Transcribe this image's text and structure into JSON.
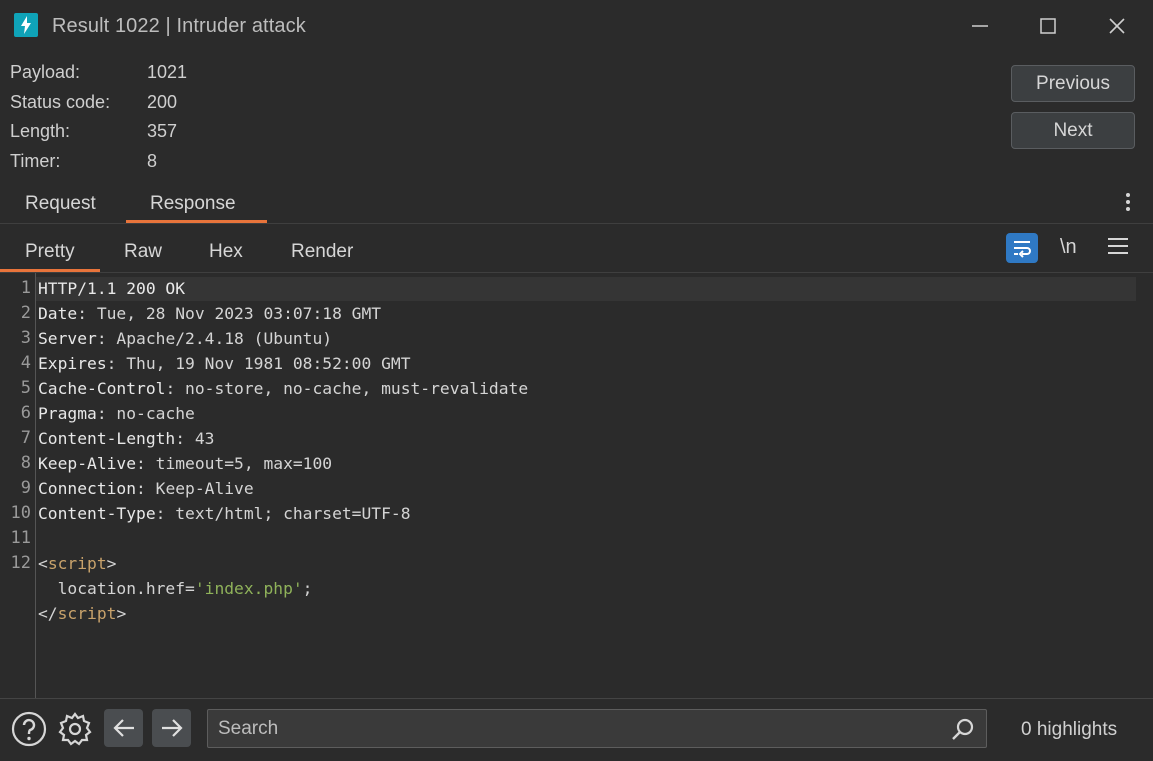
{
  "window": {
    "title": "Result 1022 | Intruder attack",
    "icon": "burp-lightning-icon",
    "accent_color": "#0fa3b8"
  },
  "info": {
    "payload_label": "Payload:",
    "payload_value": "1021",
    "status_label": "Status code:",
    "status_value": "200",
    "length_label": "Length:",
    "length_value": "357",
    "timer_label": "Timer:",
    "timer_value": "8"
  },
  "nav": {
    "previous_label": "Previous",
    "next_label": "Next"
  },
  "tabs": {
    "request": "Request",
    "response": "Response",
    "active": "Response",
    "active_color": "#e8743b"
  },
  "view_tabs": {
    "pretty": "Pretty",
    "raw": "Raw",
    "hex": "Hex",
    "render": "Render",
    "active": "Pretty"
  },
  "toolbar": {
    "newline_label": "\\n"
  },
  "editor": {
    "line_numbers": [
      "1",
      "2",
      "3",
      "4",
      "5",
      "6",
      "7",
      "8",
      "9",
      "10",
      "11",
      "12"
    ],
    "lines": [
      {
        "key": "HTTP/1.1 200 OK",
        "rest": ""
      },
      {
        "key": "Date",
        "rest": ": Tue, 28 Nov 2023 03:07:18 GMT"
      },
      {
        "key": "Server",
        "rest": ": Apache/2.4.18 (Ubuntu)"
      },
      {
        "key": "Expires",
        "rest": ": Thu, 19 Nov 1981 08:52:00 GMT"
      },
      {
        "key": "Cache-Control",
        "rest": ": no-store, no-cache, must-revalidate"
      },
      {
        "key": "Pragma",
        "rest": ": no-cache"
      },
      {
        "key": "Content-Length",
        "rest": ": 43"
      },
      {
        "key": "Keep-Alive",
        "rest": ": timeout=5, max=100"
      },
      {
        "key": "Connection",
        "rest": ": Keep-Alive"
      },
      {
        "key": "Content-Type",
        "rest": ": text/html; charset=UTF-8"
      }
    ],
    "script": {
      "open_lt": "<",
      "open_tag": "script",
      "open_gt": ">",
      "body_prefix": "  location.href=",
      "body_string": "'index.php'",
      "body_suffix": ";",
      "close_lt": "</",
      "close_tag": "script",
      "close_gt": ">"
    }
  },
  "bottom": {
    "search_placeholder": "Search",
    "highlights": "0 highlights"
  }
}
